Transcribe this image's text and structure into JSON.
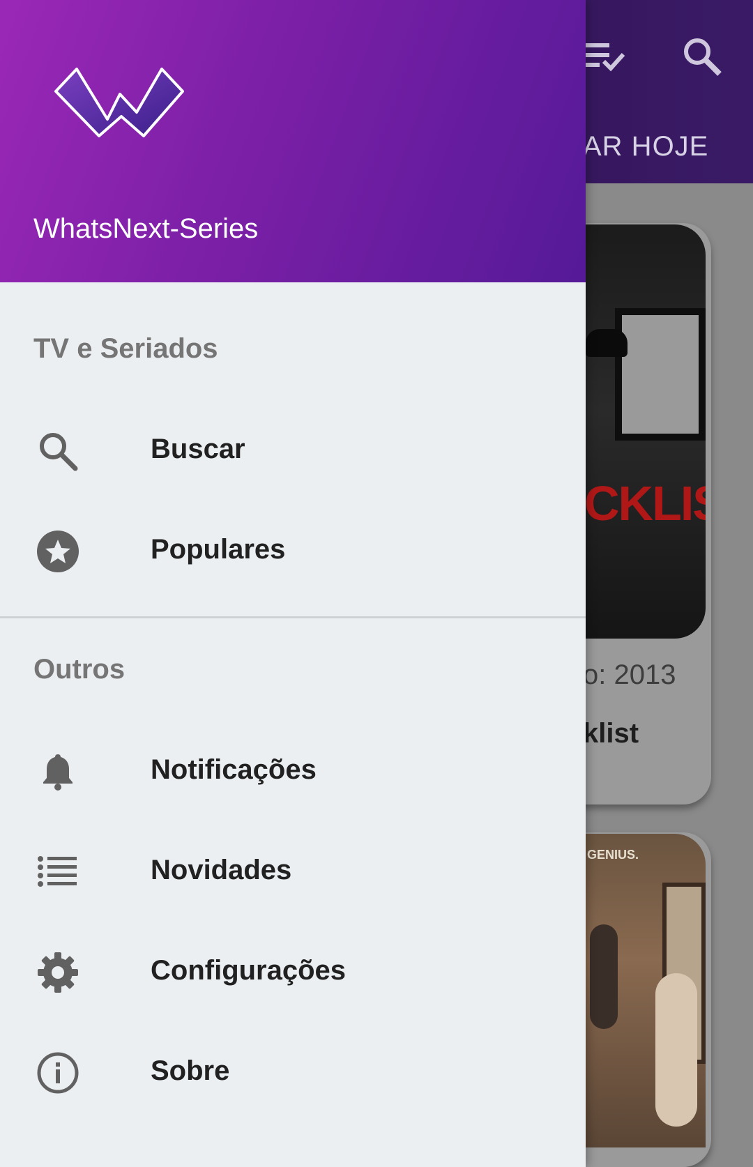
{
  "background": {
    "tab_label": "AR HOJE",
    "card1_poster_text": "CKLIST",
    "card1_year": "o: 2013",
    "card1_name": "klist",
    "card2_poster_text": "GENIUS."
  },
  "drawer": {
    "app_name": "WhatsNext-Series",
    "sections": [
      {
        "title": "TV e Seriados",
        "items": [
          {
            "label": "Buscar",
            "icon": "search-icon"
          },
          {
            "label": "Populares",
            "icon": "star-icon"
          }
        ]
      },
      {
        "title": "Outros",
        "items": [
          {
            "label": "Notificações",
            "icon": "bell-icon"
          },
          {
            "label": "Novidades",
            "icon": "list-icon"
          },
          {
            "label": "Configurações",
            "icon": "gear-icon"
          },
          {
            "label": "Sobre",
            "icon": "info-icon"
          }
        ]
      }
    ]
  },
  "colors": {
    "header_start": "#9a28b6",
    "header_end": "#551a98",
    "drawer_bg": "#eceff2",
    "section_title": "#757575",
    "item_text": "#212121",
    "icon_gray": "#616161"
  }
}
